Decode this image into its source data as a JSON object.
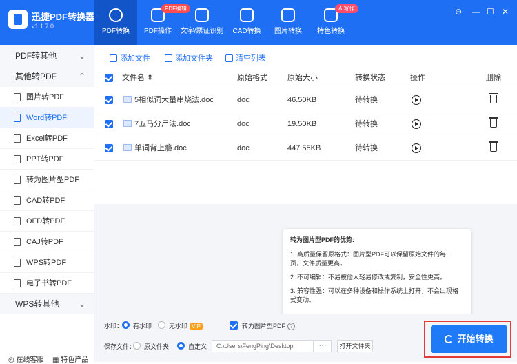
{
  "app": {
    "brand": "迅捷PDF转换器",
    "version": "v1.1.7.0"
  },
  "tabs": [
    {
      "label": "PDF转换",
      "icon": "convert-icon",
      "active": true
    },
    {
      "label": "PDF操作",
      "icon": "pdf-operate-icon",
      "badge": "PDF编辑"
    },
    {
      "label": "文字/票证识别",
      "icon": "ocr-icon"
    },
    {
      "label": "CAD转换",
      "icon": "cad-icon"
    },
    {
      "label": "图片转换",
      "icon": "image-icon"
    },
    {
      "label": "特色转换",
      "icon": "special-icon",
      "badge": "AI写作"
    }
  ],
  "window": {
    "pin": "⊖",
    "minimize": "—",
    "maximize": "☐",
    "close": "✕"
  },
  "sidebar": {
    "group1": "PDF转其他",
    "group2": "其他转PDF",
    "group3": "WPS转其他",
    "items": [
      "图片转PDF",
      "Word转PDF",
      "Excel转PDF",
      "PPT转PDF",
      "转为图片型PDF",
      "CAD转PDF",
      "OFD转PDF",
      "CAJ转PDF",
      "WPS转PDF",
      "电子书转PDF"
    ],
    "service": "在线客服",
    "products": "特色产品"
  },
  "toolbar": {
    "add_file": "添加文件",
    "add_folder": "添加文件夹",
    "clear": "清空列表"
  },
  "table": {
    "headers": {
      "name": "文件名",
      "format": "原始格式",
      "size": "原始大小",
      "status": "转换状态",
      "action": "操作",
      "delete": "删除"
    },
    "rows": [
      {
        "name": "5相似词大量串烧法.doc",
        "format": "doc",
        "size": "46.50KB",
        "status": "待转换"
      },
      {
        "name": "7五马分尸法.doc",
        "format": "doc",
        "size": "19.50KB",
        "status": "待转换"
      },
      {
        "name": "单词背上瘾.doc",
        "format": "doc",
        "size": "447.55KB",
        "status": "待转换"
      }
    ]
  },
  "tooltip": {
    "title": "转为图片型PDF的优势:",
    "p1": "1. 高质量保留原格式：图片型PDF可以保留原始文件的每一页，文件质量更高。",
    "p2": "2. 不可编辑：不易被他人轻易修改或复制，安全性更高。",
    "p3": "3. 兼容性强：可以在多种设备和操作系统上打开，不会出现格式变动。"
  },
  "bottom": {
    "watermark_label": "水印：",
    "with_watermark": "有水印",
    "no_watermark": "无水印",
    "vip": "VIP",
    "to_image_pdf": "转为图片型PDF",
    "help": "?",
    "save_label": "保存文件：",
    "orig_folder": "原文件夹",
    "custom": "自定义",
    "path": "C:\\Users\\FengPing\\Desktop",
    "browse": "···",
    "open_folder": "打开文件夹",
    "start": "开始转换"
  }
}
